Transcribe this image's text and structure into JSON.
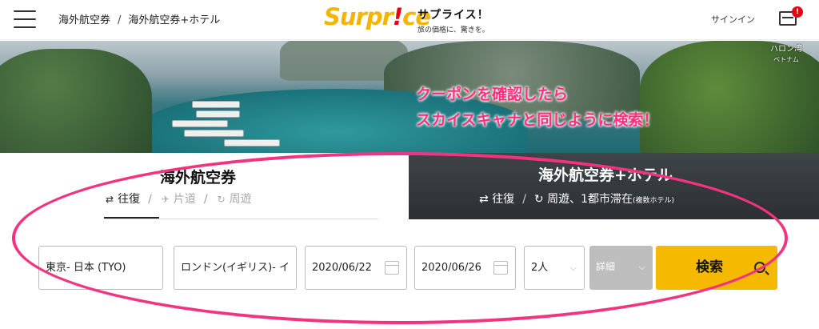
{
  "header": {
    "breadcrumb": [
      "海外航空券",
      "海外航空券+ホテル"
    ],
    "logo_main": "Surpr",
    "logo_excl": "!",
    "logo_end": "ce",
    "tagline_title": "サプライス！",
    "tagline_sub": "旅の価格に、驚きを。",
    "signin": "サインイン",
    "cart_badge": "!"
  },
  "hero": {
    "location": "ハロン湾",
    "location_sub": "ベトナム",
    "note_line1": "クーポンを確認したら",
    "note_line2": "スカイスキャナと同じように検索！"
  },
  "flight_panel": {
    "title": "海外航空券",
    "tabs": [
      {
        "label": "往復",
        "icon": "round-trip-icon"
      },
      {
        "label": "片道",
        "icon": "one-way-icon"
      },
      {
        "label": "周遊",
        "icon": "multi-city-icon"
      }
    ],
    "separator": "/"
  },
  "hotel_panel": {
    "title": "海外航空券+ホテル",
    "tab1": "往復",
    "tab2_main": "周遊、1都市滞在",
    "tab2_small": "(複数ホテル)"
  },
  "search": {
    "origin": "東京- 日本 (TYO)",
    "destination": "ロンドン(イギリス)- イ",
    "depart_date": "2020/06/22",
    "return_date": "2020/06/26",
    "passengers": "2人",
    "details": "詳細",
    "button": "検索"
  },
  "colors": {
    "brand": "#f5b400",
    "accent_red": "#e60012",
    "annotation_pink": "#f2337f",
    "search_button": "#f5b900"
  }
}
